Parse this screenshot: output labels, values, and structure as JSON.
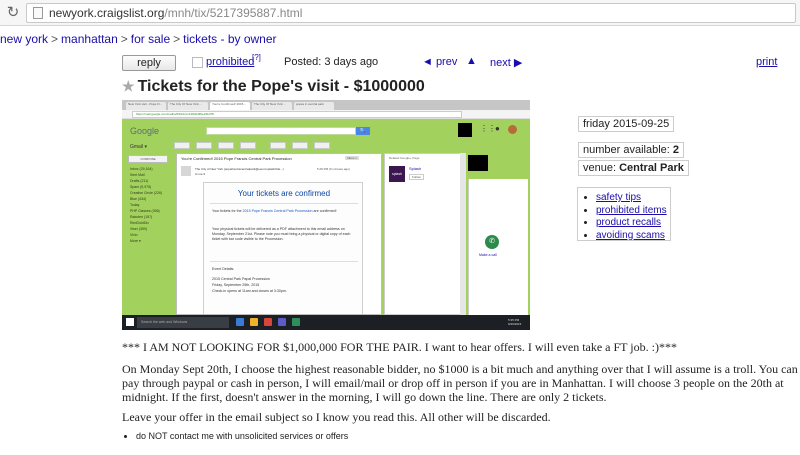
{
  "browser": {
    "url_domain": "newyork.craigslist.org",
    "url_path": "/mnh/tix/5217395887.html"
  },
  "breadcrumbs": [
    "new york",
    "manhattan",
    "for sale",
    "tickets - by owner"
  ],
  "breadcrumb_separator": ">",
  "toolbar": {
    "reply_label": "reply",
    "prohibited_label": "prohibited",
    "prohibited_sup": "[?]",
    "posted": "Posted: 3 days ago",
    "prev_label": "◄ prev",
    "up_label": "▲",
    "next_label": "next ▶",
    "print_label": "print"
  },
  "title": "Tickets for the Pope's visit - $1000000",
  "screenshot": {
    "tabs": [
      "New York visit - Pope Fr...",
      "The City Of New York ...",
      "You're Confirmed! 2015...",
      "The City Of New York ...",
      "popes in central park"
    ],
    "url": "https://mail.google.com/mail/u/0/#inbox/14fb4b0f0e23bd78",
    "gmail_logo": "Google",
    "gmail_label": "Gmail ▾",
    "search_button": "🔍",
    "compose": "COMPOSE",
    "nav_items": [
      "Inbox (29,164)",
      "Sent Mail",
      "Drafts (211)",
      "Spam (5,975)",
      "Creative Circle (226)",
      "Blue (434)",
      "Today",
      "PHP Classes (396)",
      "Rakuten (157)",
      "RedGoldDiv",
      "Viser (359)",
      "Vivin",
      "More ▾"
    ],
    "email_subject": "You're Confirmed! 2015 Pope Francis Central Park Procession",
    "inbox_tag": "Inbox ×",
    "email_from": "The City of New York (popefranciscentralpark@event.splashthat...)",
    "email_to": "to me ▾",
    "email_time": "5:29 PM (6 minutes ago)",
    "card_title": "Your tickets are confirmed",
    "para1_pre": "Your tickets for the ",
    "para1_link": "2015 Pope Francis Central Park Procession",
    "para1_post": " are confirmed!",
    "para2": "Your physical tickets will be delivered as a PDF attachment to this email address on Monday, September 21st. Please note you must bring a physical or digital copy of each ticket with bar code visible to the Procession.",
    "details_label": "Event Details:",
    "details_lines": [
      "2015 Central Park Papal Procession",
      "Friday, September 25th, 2015",
      "Check-in opens at 11am and closes at 3:30pm."
    ],
    "side_label": "Related Google+ Page",
    "splash_logo": "splash",
    "splash_name": "Splash",
    "splash_follow": "Follow",
    "make_call": "Make a call",
    "taskbar_search": "Search the web and Windows",
    "clock": "5:35 PM\n9/20/2015"
  },
  "attributes": {
    "date": "friday 2015-09-25",
    "number_label": "number available: ",
    "number_value": "2",
    "venue_label": "venue: ",
    "venue_value": "Central Park"
  },
  "safety_links": [
    "safety tips",
    "prohibited items",
    "product recalls",
    "avoiding scams"
  ],
  "body": {
    "p1": "*** I AM NOT LOOKING FOR $1,000,000 FOR THE PAIR. I want to hear offers. I will even take a FT job. :)***",
    "p2": "On Monday Sept 20th, I choose the highest reasonable bidder, no $1000 is a bit much and anything over that I will assume is a troll. You can pay through paypal or cash in person, I will email/mail or drop off in person if you are in Manhattan. I will choose 3 people on the 20th at midnight. If the first, doesn't answer in the morning, I will go down the line. There are only 2 tickets.",
    "p3": "Leave your offer in the email subject so I know you read this. All other will be discarded."
  },
  "notices": [
    "do NOT contact me with unsolicited services or offers"
  ],
  "colors": {
    "link": "#1a0dab",
    "gmail_green": "#a3d15e"
  }
}
